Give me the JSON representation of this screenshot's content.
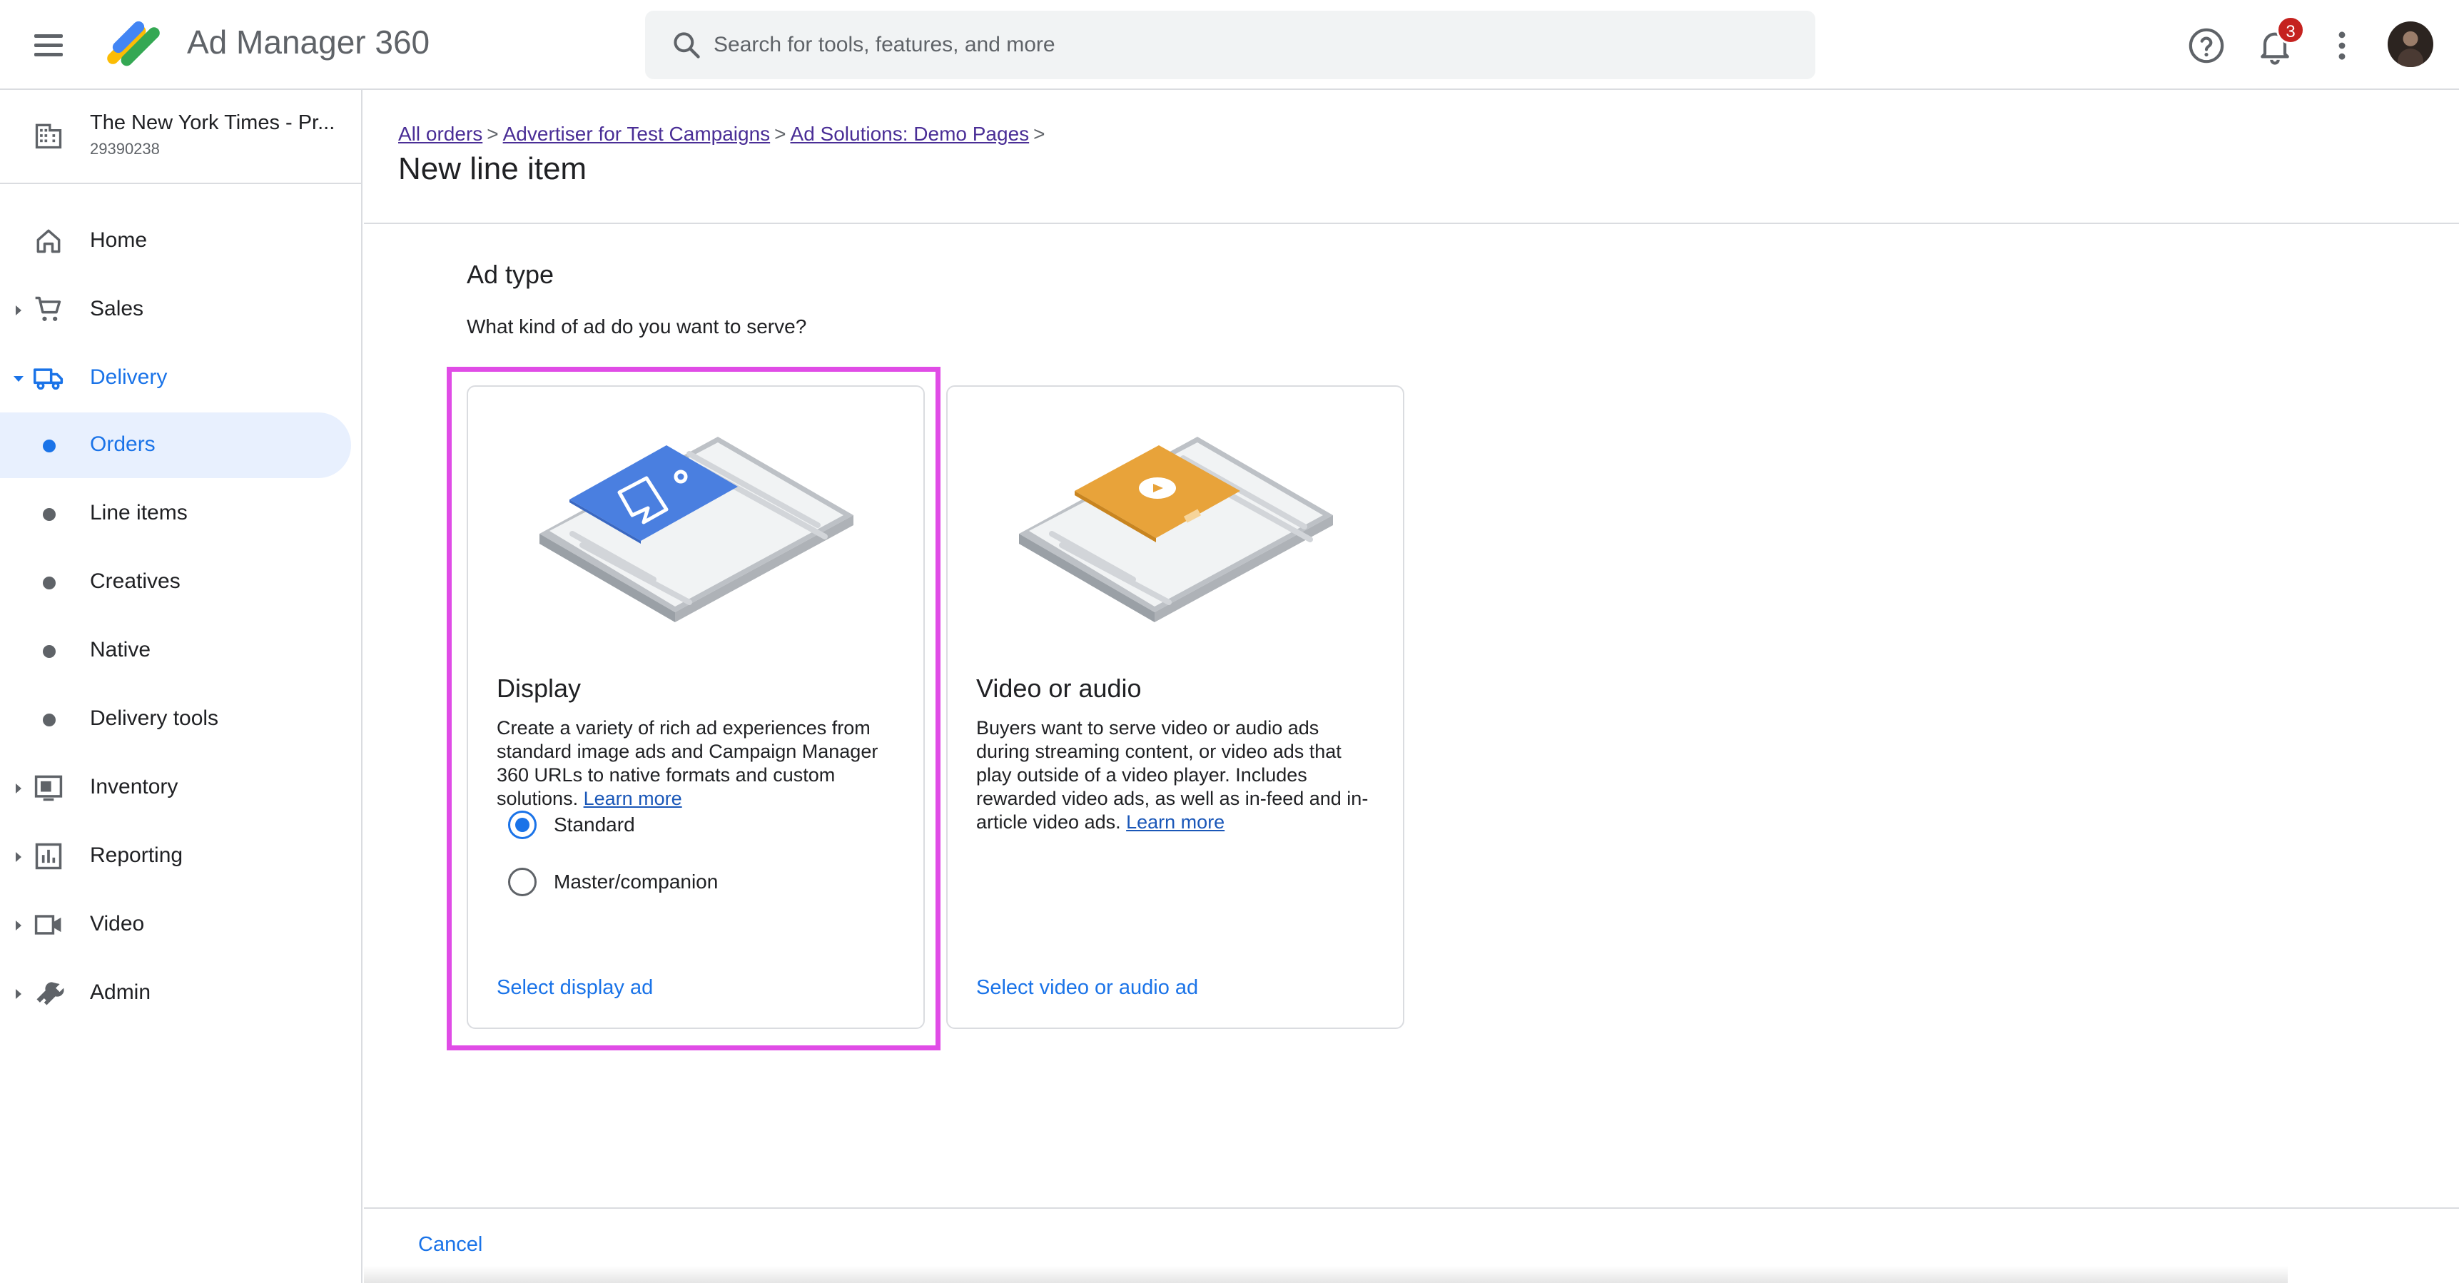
{
  "app": {
    "title": "Ad Manager 360"
  },
  "search": {
    "placeholder": "Search for tools, features, and more"
  },
  "topbar": {
    "notification_count": "3"
  },
  "network": {
    "name": "The New York Times - Pr...",
    "id": "29390238"
  },
  "nav": {
    "home": "Home",
    "sales": "Sales",
    "delivery": "Delivery",
    "orders": "Orders",
    "line_items": "Line items",
    "creatives": "Creatives",
    "native": "Native",
    "delivery_tools": "Delivery tools",
    "inventory": "Inventory",
    "reporting": "Reporting",
    "video": "Video",
    "admin": "Admin"
  },
  "breadcrumb": {
    "all_orders": "All orders",
    "advertiser": "Advertiser for Test Campaigns",
    "order": "Ad Solutions: Demo Pages",
    "separator": ">"
  },
  "page": {
    "title": "New line item"
  },
  "ad_type": {
    "title": "Ad type",
    "question": "What kind of ad do you want to serve?"
  },
  "cards": {
    "display": {
      "title": "Display",
      "description": "Create a variety of rich ad experiences from standard image ads and Campaign Manager 360 URLs to native formats and custom solutions.",
      "learn_more": "Learn more",
      "options": [
        "Standard",
        "Master/companion"
      ],
      "selected_option": "Standard",
      "action": "Select display ad"
    },
    "video": {
      "title": "Video or audio",
      "description": "Buyers want to serve video or audio ads during streaming content, or video ads that play outside of a video player. Includes rewarded video ads, as well as in-feed and in-article video ads.",
      "learn_more": "Learn more",
      "action": "Select video or audio ad"
    }
  },
  "footer": {
    "cancel": "Cancel"
  },
  "colors": {
    "accent": "#1a73e8",
    "highlight": "#e04ce6",
    "badge": "#c5221f",
    "display_illustration": "#4a7fe0",
    "video_illustration": "#e8a33a"
  }
}
